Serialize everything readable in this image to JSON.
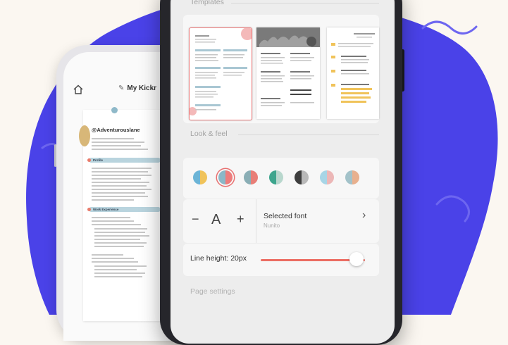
{
  "colors": {
    "background": "#fbf7f1",
    "blob": "#4a42e8",
    "accent": "#ec6d63"
  },
  "back_phone": {
    "title": "My Kickr",
    "home_icon": "home-icon",
    "edit_icon": "pencil-icon",
    "resume": {
      "name": "@Adventurouslane",
      "sections": [
        "Profile",
        "Work Experience"
      ]
    }
  },
  "editor": {
    "templates_label": "Templates",
    "templates_count": 3,
    "selected_template": 1,
    "look_label": "Look & feel",
    "swatches": [
      {
        "left": "#6cb4d6",
        "right": "#f0c35a"
      },
      {
        "left": "#8ab8c8",
        "right": "#ee7c7c"
      },
      {
        "left": "#8aaeb5",
        "right": "#e87e77"
      },
      {
        "left": "#3da58d",
        "right": "#b8d7cd"
      },
      {
        "left": "#3e3e3e",
        "right": "#b9b9b9"
      },
      {
        "left": "#a7d5e6",
        "right": "#ecb7b7"
      },
      {
        "left": "#a3c2c9",
        "right": "#e8b08e"
      }
    ],
    "selected_swatch": 1,
    "font": {
      "decrease": "−",
      "glyph": "A",
      "increase": "+",
      "label": "Selected font",
      "value": "Nunito",
      "chevron": "›"
    },
    "line_height_label": "Line height: 20px",
    "line_height_fill": 0.92,
    "page_settings_label": "Page settings"
  }
}
